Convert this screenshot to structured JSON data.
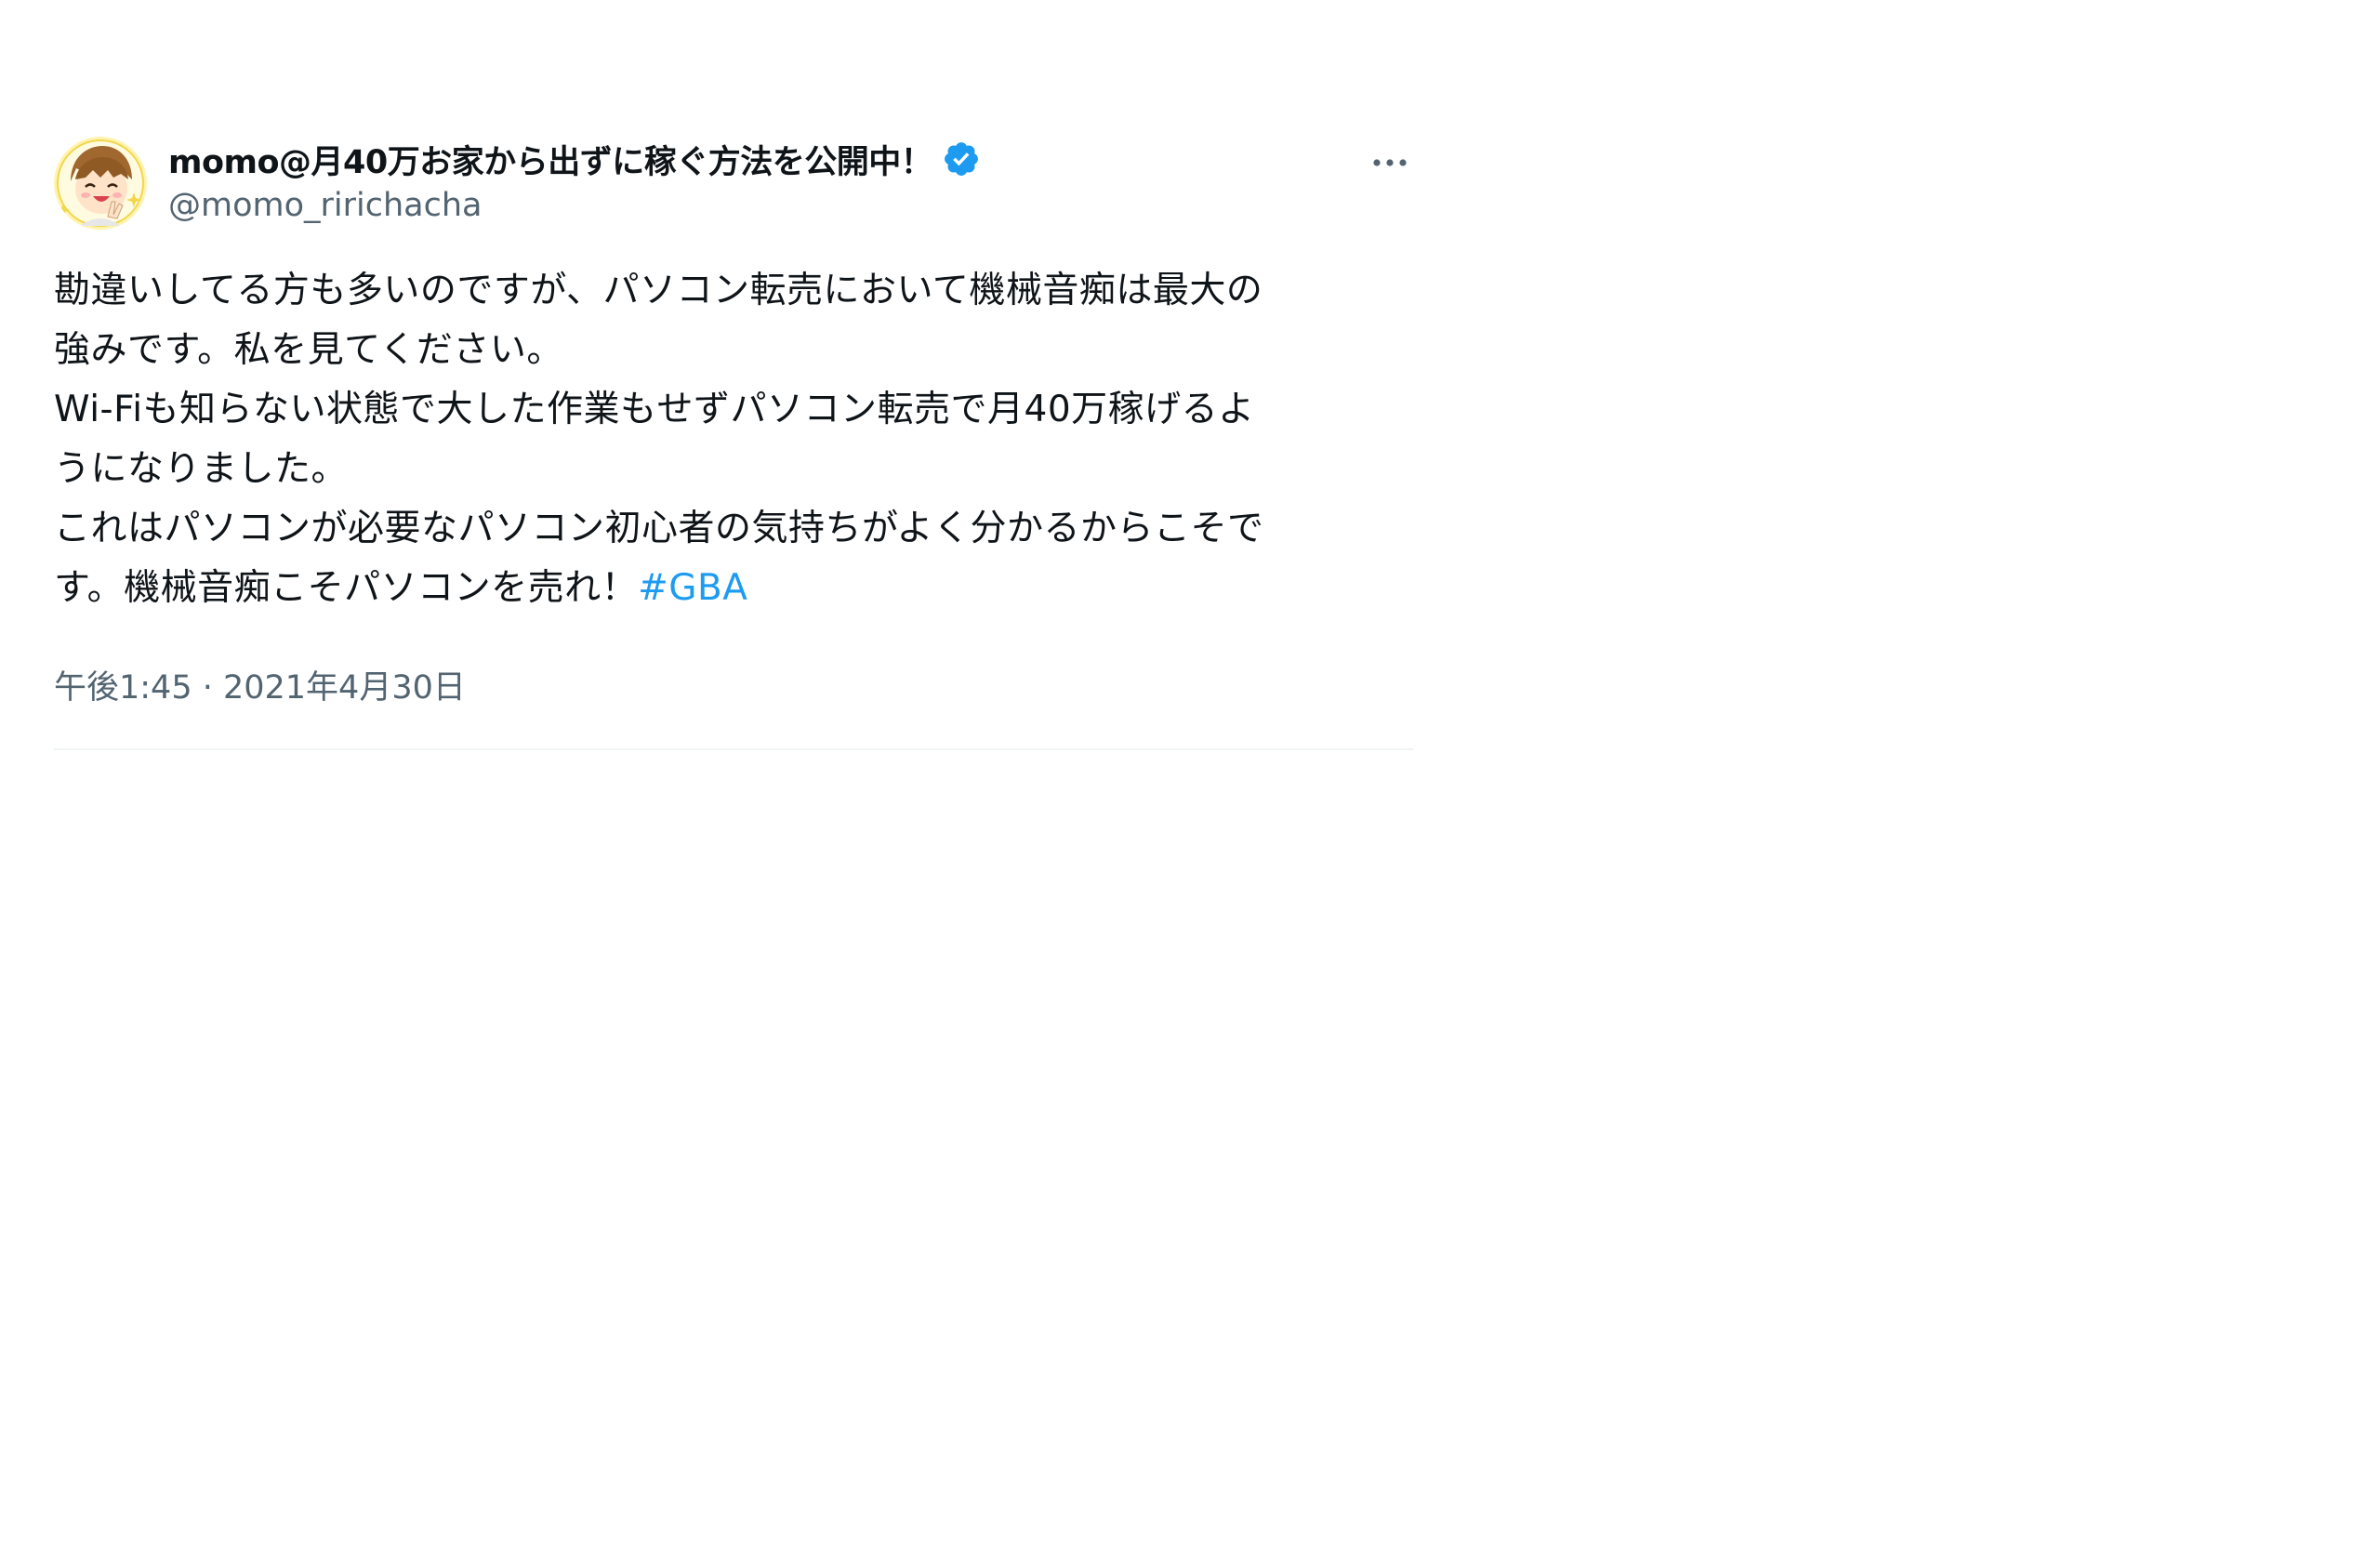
{
  "tweet": {
    "display_name": "momo@月40万お家から出ずに稼ぐ方法を公開中！",
    "handle": "@momo_ririchacha",
    "verified_icon": "verified-badge-icon",
    "more_icon": "more-icon",
    "avatar_icon": "avatar",
    "body_lines": [
      "勘違いしてる方も多いのですが、パソコン転売において機械音痴は最大の",
      "強みです。私を見てください。",
      "Wi-Fiも知らない状態で大した作業もせずパソコン転売で月40万稼げるよ",
      "うになりました。",
      "これはパソコンが必要なパソコン初心者の気持ちがよく分かるからこそで",
      "す。機械音痴こそパソコンを売れ！"
    ],
    "hashtag": "#GBA",
    "timestamp": "午後1:45 · 2021年4月30日"
  },
  "colors": {
    "text": "#0f1419",
    "secondary": "#536471",
    "link": "#1d9bf0",
    "verified": "#1d9bf0",
    "divider": "#eff3f4"
  }
}
